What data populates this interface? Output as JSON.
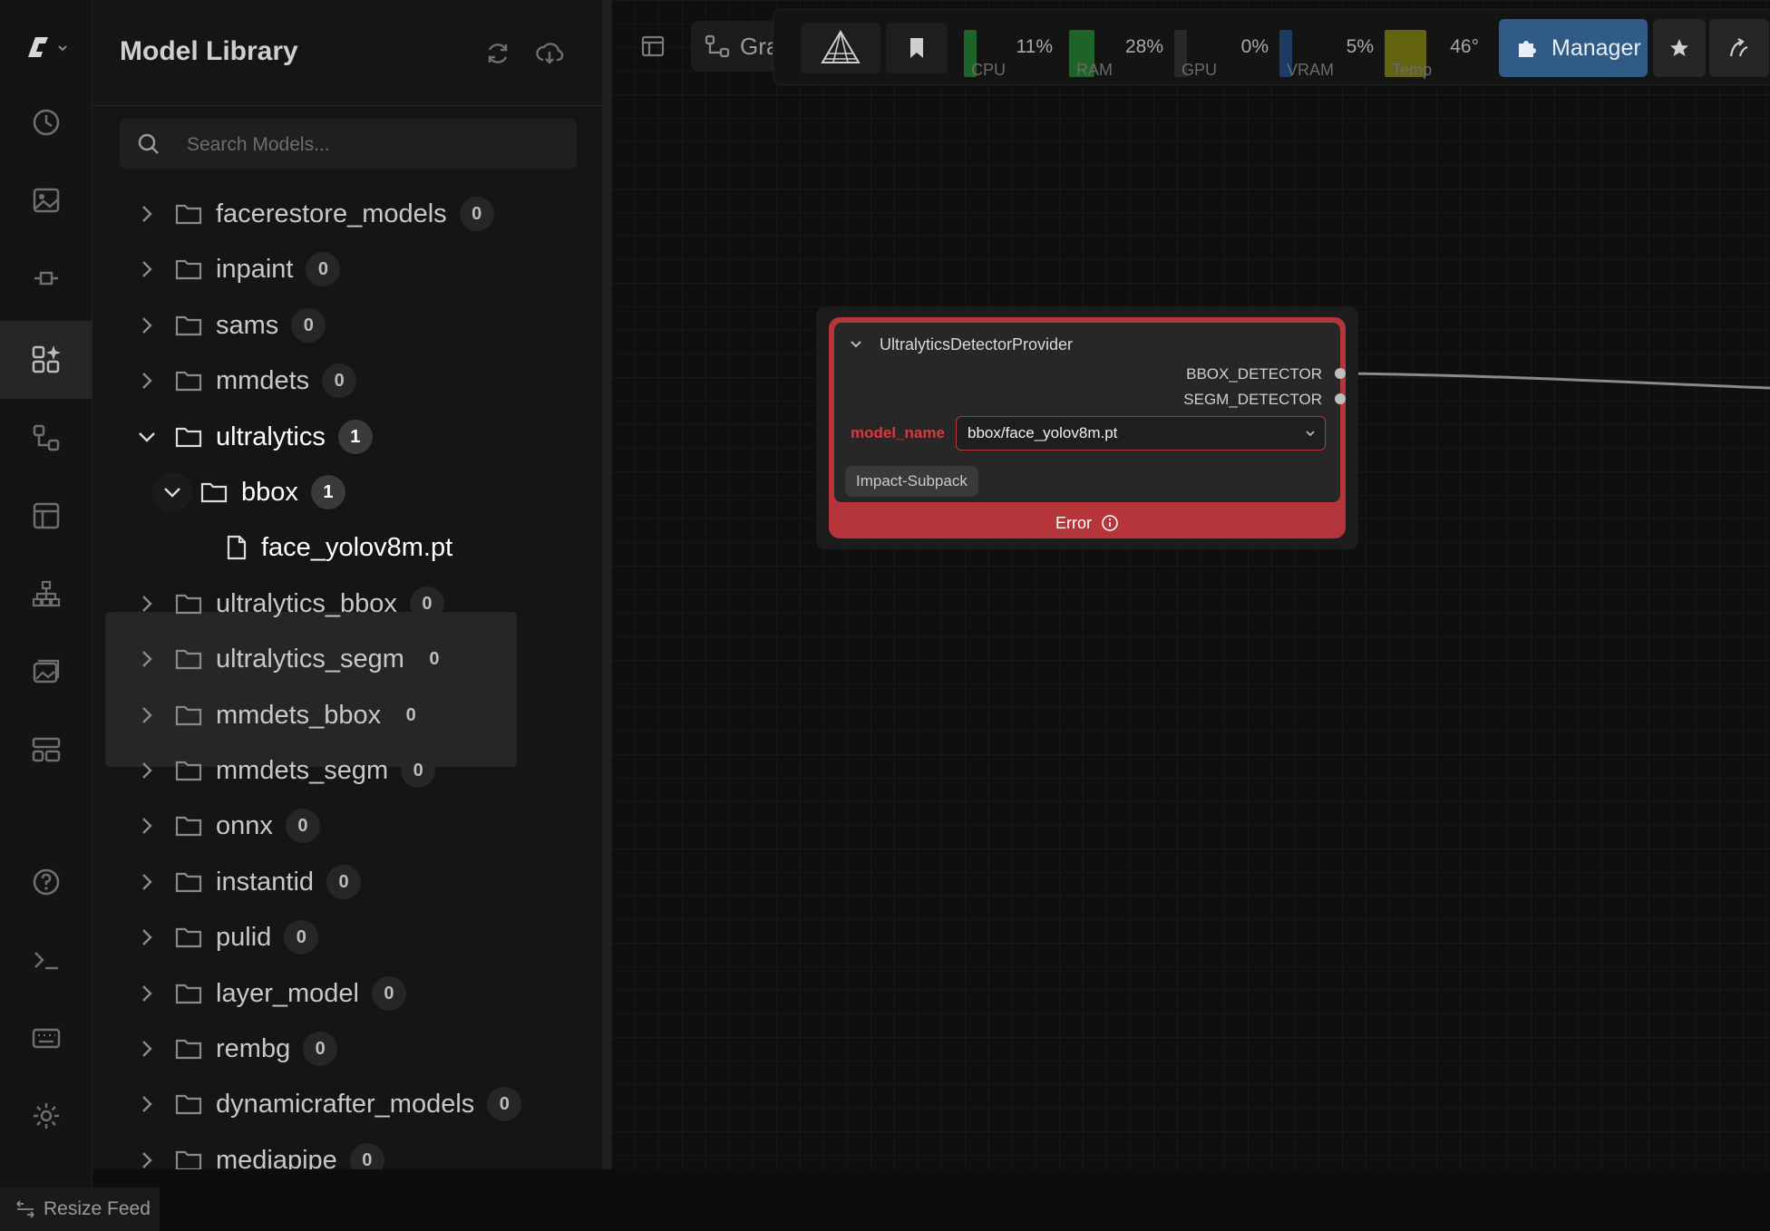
{
  "library": {
    "title": "Model Library",
    "search_placeholder": "Search Models...",
    "folders": [
      {
        "label": "facerestore_models",
        "count": "0"
      },
      {
        "label": "inpaint",
        "count": "0"
      },
      {
        "label": "sams",
        "count": "0"
      },
      {
        "label": "mmdets",
        "count": "0"
      },
      {
        "label": "ultralytics",
        "count": "1"
      },
      {
        "label": "bbox",
        "count": "1"
      },
      {
        "label": "face_yolov8m.pt"
      },
      {
        "label": "ultralytics_bbox",
        "count": "0"
      },
      {
        "label": "ultralytics_segm",
        "count": "0"
      },
      {
        "label": "mmdets_bbox",
        "count": "0"
      },
      {
        "label": "mmdets_segm",
        "count": "0"
      },
      {
        "label": "onnx",
        "count": "0"
      },
      {
        "label": "instantid",
        "count": "0"
      },
      {
        "label": "pulid",
        "count": "0"
      },
      {
        "label": "layer_model",
        "count": "0"
      },
      {
        "label": "rembg",
        "count": "0"
      },
      {
        "label": "dynamicrafter_models",
        "count": "0"
      },
      {
        "label": "mediapipe",
        "count": "0"
      }
    ]
  },
  "topbar": {
    "graph_tab": "Gra",
    "meters": [
      {
        "name": "CPU",
        "percent": "11%",
        "color": "#1f6b2a",
        "level": 0.11
      },
      {
        "name": "RAM",
        "percent": "28%",
        "color": "#1f6b2a",
        "level": 0.28
      },
      {
        "name": "GPU",
        "percent": "0%",
        "color": "#2a2a2a",
        "level": 0.0
      },
      {
        "name": "VRAM",
        "percent": "5%",
        "color": "#1f3f6b",
        "level": 0.05
      },
      {
        "name": "Temp",
        "percent": "46°",
        "color": "#6b6b12",
        "level": 0.46
      }
    ],
    "manager_label": "Manager"
  },
  "node": {
    "title": "UltralyticsDetectorProvider",
    "outputs": [
      "BBOX_DETECTOR",
      "SEGM_DETECTOR"
    ],
    "widget_label": "model_name",
    "widget_value": "bbox/face_yolov8m.pt",
    "tag": "Impact-Subpack",
    "status": "Error",
    "accent_color": "#b5353b"
  },
  "footer": {
    "resize_feed": "Resize Feed"
  }
}
